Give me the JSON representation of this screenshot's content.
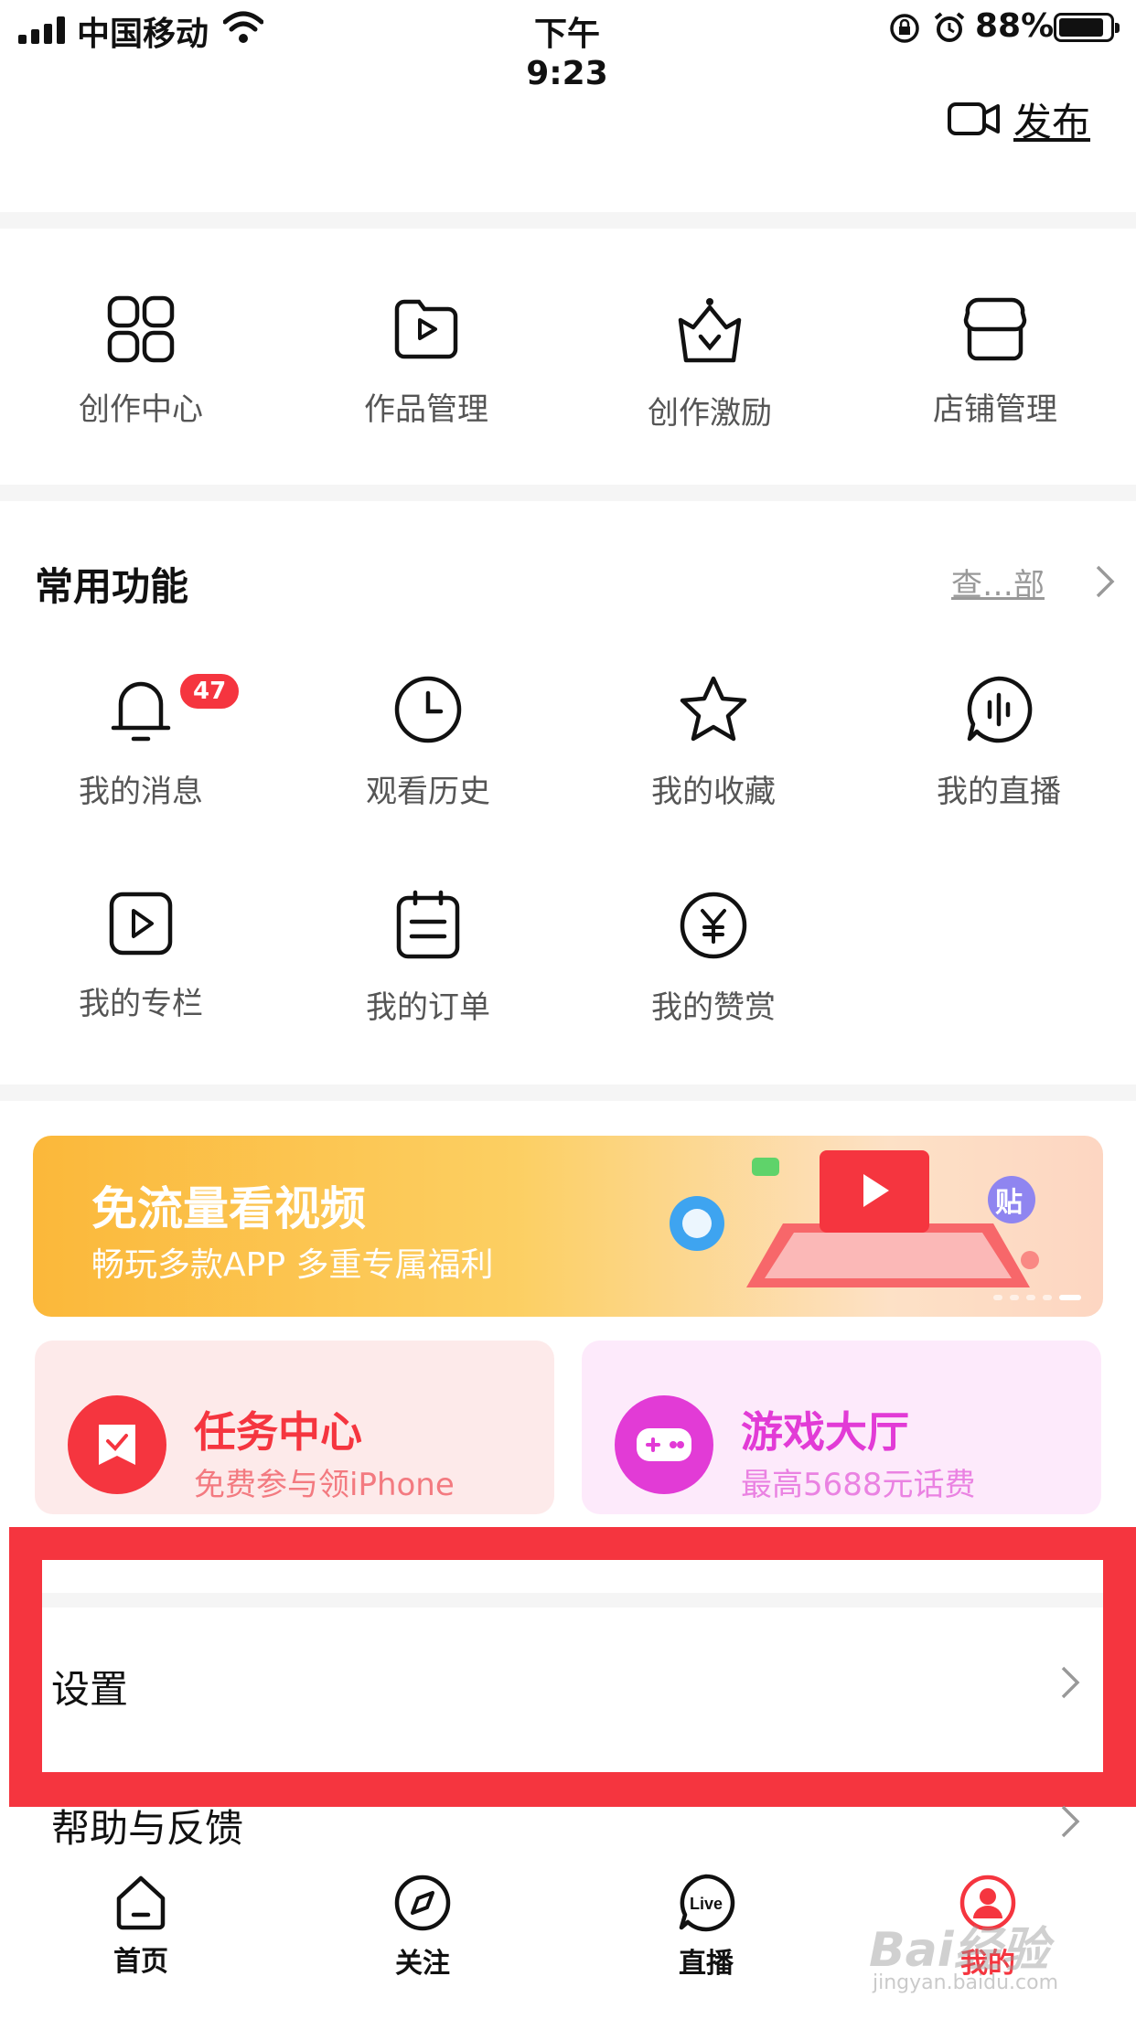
{
  "status_bar": {
    "carrier": "中国移动",
    "time": "下午 9:23",
    "battery_pct": "88%",
    "battery_level": 0.88
  },
  "header": {
    "publish_label": "发布",
    "publish_icon": "video-camera-icon"
  },
  "creator_tools": [
    {
      "label": "创作中心",
      "icon": "grid-apps-icon"
    },
    {
      "label": "作品管理",
      "icon": "folder-play-icon"
    },
    {
      "label": "创作激励",
      "icon": "crown-icon"
    },
    {
      "label": "店铺管理",
      "icon": "store-icon"
    }
  ],
  "common_functions": {
    "title": "常用功能",
    "view_all": "查…部",
    "items": [
      {
        "label": "我的消息",
        "icon": "bell-icon",
        "badge": "47"
      },
      {
        "label": "观看历史",
        "icon": "clock-icon"
      },
      {
        "label": "我的收藏",
        "icon": "star-icon"
      },
      {
        "label": "我的直播",
        "icon": "live-audio-icon"
      },
      {
        "label": "我的专栏",
        "icon": "column-play-icon"
      },
      {
        "label": "我的订单",
        "icon": "order-clipboard-icon"
      },
      {
        "label": "我的赞赏",
        "icon": "yen-coin-icon"
      }
    ]
  },
  "banner": {
    "title": "免流量看视频",
    "subtitle": "畅玩多款APP 多重专属福利",
    "badge_text": "贴"
  },
  "cards": [
    {
      "title": "任务中心",
      "subtitle": "免费参与领iPhone",
      "color": "#f5353f",
      "bg": "#fdeaea",
      "sub_color": "#f37a80"
    },
    {
      "title": "游戏大厅",
      "subtitle": "最高5688元话费",
      "color": "#e23bd6",
      "bg": "#fdeafb",
      "sub_color": "#ea82e2"
    }
  ],
  "menu": {
    "settings": "设置",
    "help": "帮助与反馈"
  },
  "bottom_nav": [
    {
      "label": "首页",
      "icon": "home-icon"
    },
    {
      "label": "关注",
      "icon": "compass-icon"
    },
    {
      "label": "直播",
      "icon": "live-icon"
    },
    {
      "label": "我的",
      "icon": "profile-icon",
      "active": true
    }
  ],
  "watermark": {
    "text": "Bai经验",
    "sub": "jingyan.baidu.com"
  },
  "colors": {
    "accent": "#f5353f",
    "highlight_frame": "#f5353f"
  }
}
